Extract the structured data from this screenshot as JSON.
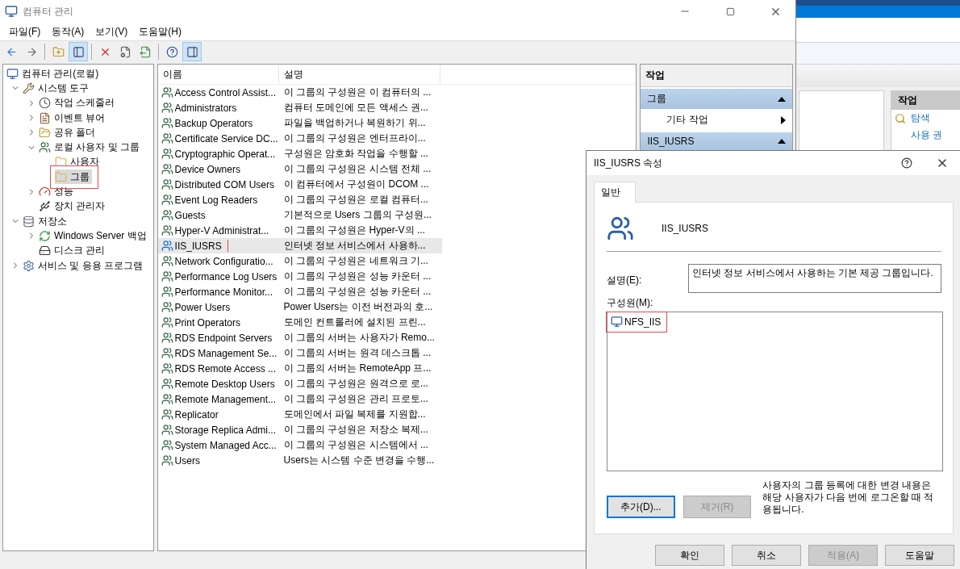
{
  "window": {
    "title": "컴퓨터 관리",
    "menu": [
      "파일(F)",
      "동작(A)",
      "보기(V)",
      "도움말(H)"
    ],
    "toolbar": [
      {
        "kind": "back",
        "pressed": false
      },
      {
        "kind": "forward",
        "pressed": false
      },
      {
        "kind": "separator"
      },
      {
        "kind": "up",
        "pressed": false
      },
      {
        "kind": "tree",
        "pressed": true
      },
      {
        "kind": "separator"
      },
      {
        "kind": "delete",
        "pressed": false
      },
      {
        "kind": "properties",
        "pressed": false
      },
      {
        "kind": "export",
        "pressed": false
      },
      {
        "kind": "separator"
      },
      {
        "kind": "help",
        "pressed": false
      },
      {
        "kind": "pane",
        "pressed": true
      }
    ]
  },
  "tree": [
    {
      "label": "컴퓨터 관리(로컬)",
      "kind": "computer",
      "selected": false,
      "children": [
        {
          "label": "시스템 도구",
          "kind": "tools",
          "selected": false,
          "expanded": true,
          "children": [
            {
              "label": "작업 스케줄러",
              "kind": "clock",
              "selected": false,
              "expanded": false
            },
            {
              "label": "이벤트 뷰어",
              "kind": "event",
              "selected": false,
              "expanded": false
            },
            {
              "label": "공유 폴더",
              "kind": "share",
              "selected": false,
              "expanded": false
            },
            {
              "label": "로컬 사용자 및 그룹",
              "kind": "users",
              "selected": false,
              "expanded": true,
              "children": [
                {
                  "label": "사용자",
                  "kind": "folder",
                  "selected": false
                },
                {
                  "label": "그룹",
                  "kind": "folder",
                  "selected": true,
                  "highlighted": true
                }
              ]
            },
            {
              "label": "성능",
              "kind": "perf",
              "selected": false,
              "expanded": false
            },
            {
              "label": "장치 관리자",
              "kind": "device",
              "selected": false
            }
          ]
        },
        {
          "label": "저장소",
          "kind": "storage",
          "selected": false,
          "expanded": true,
          "children": [
            {
              "label": "Windows Server 백업",
              "kind": "backup",
              "selected": false,
              "expanded": false
            },
            {
              "label": "디스크 관리",
              "kind": "disk",
              "selected": false
            }
          ]
        },
        {
          "label": "서비스 및 응용 프로그램",
          "kind": "services",
          "selected": false,
          "expanded": false
        }
      ]
    }
  ],
  "list": {
    "columns": [
      "이름",
      "설명"
    ],
    "rows": [
      {
        "name": "Access Control Assist...",
        "description": "이 그룹의 구성원은 이 컴퓨터의 ...",
        "selected": false
      },
      {
        "name": "Administrators",
        "description": "컴퓨터 도메인에 모든 액세스 권...",
        "selected": false
      },
      {
        "name": "Backup Operators",
        "description": "파일을 백업하거나 복원하기 위...",
        "selected": false
      },
      {
        "name": "Certificate Service DC...",
        "description": "이 그룹의 구성원은 엔터프라이...",
        "selected": false
      },
      {
        "name": "Cryptographic Operat...",
        "description": "구성원은 암호화 작업을 수행할 ...",
        "selected": false
      },
      {
        "name": "Device Owners",
        "description": "이 그룹의 구성원은 시스템 전체 ...",
        "selected": false
      },
      {
        "name": "Distributed COM Users",
        "description": "이 컴퓨터에서 구성원이 DCOM ...",
        "selected": false
      },
      {
        "name": "Event Log Readers",
        "description": "이 그룹의 구성원은 로컬 컴퓨터...",
        "selected": false
      },
      {
        "name": "Guests",
        "description": "기본적으로 Users 그룹의 구성원...",
        "selected": false
      },
      {
        "name": "Hyper-V Administrat...",
        "description": "이 그룹의 구성원은 Hyper-V의 ...",
        "selected": false
      },
      {
        "name": "IIS_IUSRS",
        "description": "인터넷 정보 서비스에서 사용하...",
        "selected": true,
        "highlighted": true
      },
      {
        "name": "Network Configuratio...",
        "description": "이 그룹의 구성원은 네트워크 기...",
        "selected": false
      },
      {
        "name": "Performance Log Users",
        "description": "이 그룹의 구성원은 성능 카운터 ...",
        "selected": false
      },
      {
        "name": "Performance Monitor...",
        "description": "이 그룹의 구성원은 성능 카운터 ...",
        "selected": false
      },
      {
        "name": "Power Users",
        "description": "Power Users는 이전 버전과의 호...",
        "selected": false
      },
      {
        "name": "Print Operators",
        "description": "도메인 컨트롤러에 설치된 프린...",
        "selected": false
      },
      {
        "name": "RDS Endpoint Servers",
        "description": "이 그룹의 서버는 사용자가 Remo...",
        "selected": false
      },
      {
        "name": "RDS Management Se...",
        "description": "이 그룹의 서버는 원격 데스크톱 ...",
        "selected": false
      },
      {
        "name": "RDS Remote Access ...",
        "description": "이 그룹의 서버는 RemoteApp 프...",
        "selected": false
      },
      {
        "name": "Remote Desktop Users",
        "description": "이 그룹의 구성원은 원격으로 로...",
        "selected": false
      },
      {
        "name": "Remote Management...",
        "description": "이 그룹의 구성원은 관리 프로토...",
        "selected": false
      },
      {
        "name": "Replicator",
        "description": "도메인에서 파일 복제를 지원합...",
        "selected": false
      },
      {
        "name": "Storage Replica Admi...",
        "description": "이 그룹의 구성원은 저장소 복제...",
        "selected": false
      },
      {
        "name": "System Managed Acc...",
        "description": "이 그룹의 구성원은 시스템에서 ...",
        "selected": false
      },
      {
        "name": "Users",
        "description": "Users는 시스템 수준 변경을 수행...",
        "selected": false
      }
    ]
  },
  "actions": {
    "title": "작업",
    "sections": [
      {
        "title": "그룹",
        "expanded": true,
        "items": [
          {
            "label": "기타 작업",
            "submenu": true
          }
        ]
      },
      {
        "title": "IIS_IUSRS",
        "expanded": true
      }
    ]
  },
  "background_window": {
    "actions_title": "작업",
    "links": [
      "탐색",
      "사용 권"
    ]
  },
  "dialog": {
    "title": "IIS_IUSRS 속성",
    "tabs": [
      {
        "label": "일반",
        "selected": true
      }
    ],
    "group_name": "IIS_IUSRS",
    "description_label": "설명(E):",
    "description_value": "인터넷 정보 서비스에서 사용하는 기본 제공 그룹입니다.",
    "members_label": "구성원(M):",
    "members": [
      {
        "name": "NFS_IIS",
        "highlighted": true
      }
    ],
    "member_buttons": [
      {
        "label": "추가(D)...",
        "disabled": false,
        "focused": true
      },
      {
        "label": "제거(R)",
        "disabled": true,
        "focused": false
      }
    ],
    "note": "사용자의 그룹 등록에 대한 변경 내용은 해당 사용자가 다음 번에 로그온할 때 적용됩니다.",
    "buttons": [
      {
        "label": "확인",
        "disabled": false
      },
      {
        "label": "취소",
        "disabled": false
      },
      {
        "label": "적용(A)",
        "disabled": true
      },
      {
        "label": "도움말",
        "disabled": false
      }
    ]
  }
}
